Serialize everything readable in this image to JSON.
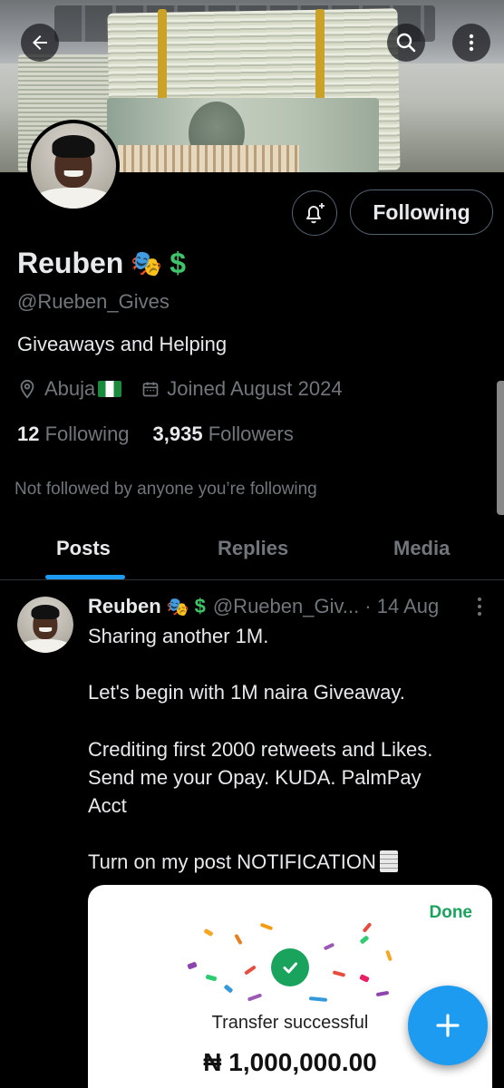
{
  "profile": {
    "name": "Reuben",
    "name_emoji": "🎭",
    "name_symbol": "$",
    "handle": "@Rueben_Gives",
    "bio": "Giveaways and Helping",
    "location": "Abuja",
    "joined": "Joined August 2024",
    "following_count": "12",
    "following_label": "Following",
    "followers_count": "3,935",
    "followers_label": "Followers",
    "not_followed_note": "Not followed by anyone you’re following"
  },
  "actions": {
    "following_button": "Following"
  },
  "tabs": [
    {
      "label": "Posts",
      "active": true
    },
    {
      "label": "Replies",
      "active": false
    },
    {
      "label": "Media",
      "active": false
    }
  ],
  "post": {
    "author": "Reuben",
    "author_emoji": "🎭",
    "author_symbol": "$",
    "meta": "@Rueben_Giv... · 14 Aug",
    "lines": [
      "Sharing another 1M.",
      "Let's begin with 1M naira Giveaway.",
      "Crediting first 2000 retweets and Likes.",
      "Send me your Opay. KUDA. PalmPay",
      "Acct",
      "Turn on my post NOTIFICATION"
    ],
    "card": {
      "done": "Done",
      "status": "Transfer successful",
      "amount": "₦ 1,000,000.00"
    }
  },
  "icons": {
    "back": "back-arrow-icon",
    "search": "search-icon",
    "more": "more-vertical-icon",
    "bell": "bell-plus-icon",
    "location": "location-pin-icon",
    "calendar": "calendar-icon",
    "compose": "plus-icon"
  },
  "colors": {
    "accent": "#1d9bf0",
    "success": "#1aa35d",
    "muted": "#71767b",
    "text": "#e7e9ea"
  }
}
